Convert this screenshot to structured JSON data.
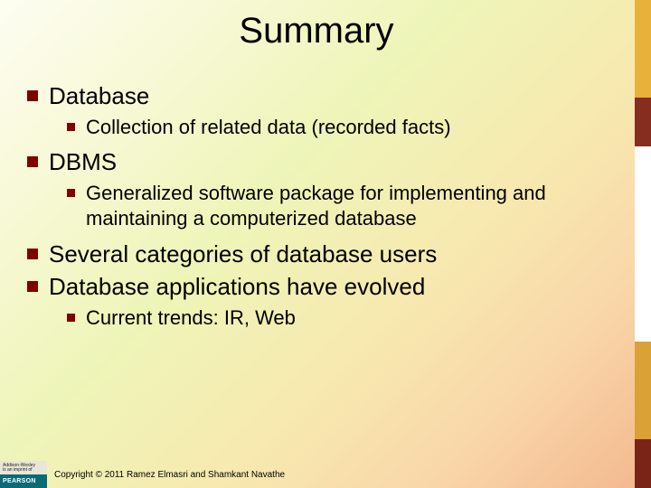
{
  "title": "Summary",
  "items": [
    {
      "text": "Database",
      "sub": [
        {
          "text": "Collection of related data (recorded facts)"
        }
      ]
    },
    {
      "text": "DBMS",
      "sub": [
        {
          "text": "Generalized software package for implementing and maintaining a computerized database"
        }
      ]
    },
    {
      "text": "Several categories of database users",
      "sub": []
    },
    {
      "text": "Database applications have evolved",
      "sub": [
        {
          "text": "Current trends: IR, Web"
        }
      ]
    }
  ],
  "publisher": {
    "line1": "Addison-Wesley",
    "line2": "is an imprint of",
    "brand": "PEARSON"
  },
  "copyright": "Copyright © 2011 Ramez Elmasri and Shamkant Navathe"
}
